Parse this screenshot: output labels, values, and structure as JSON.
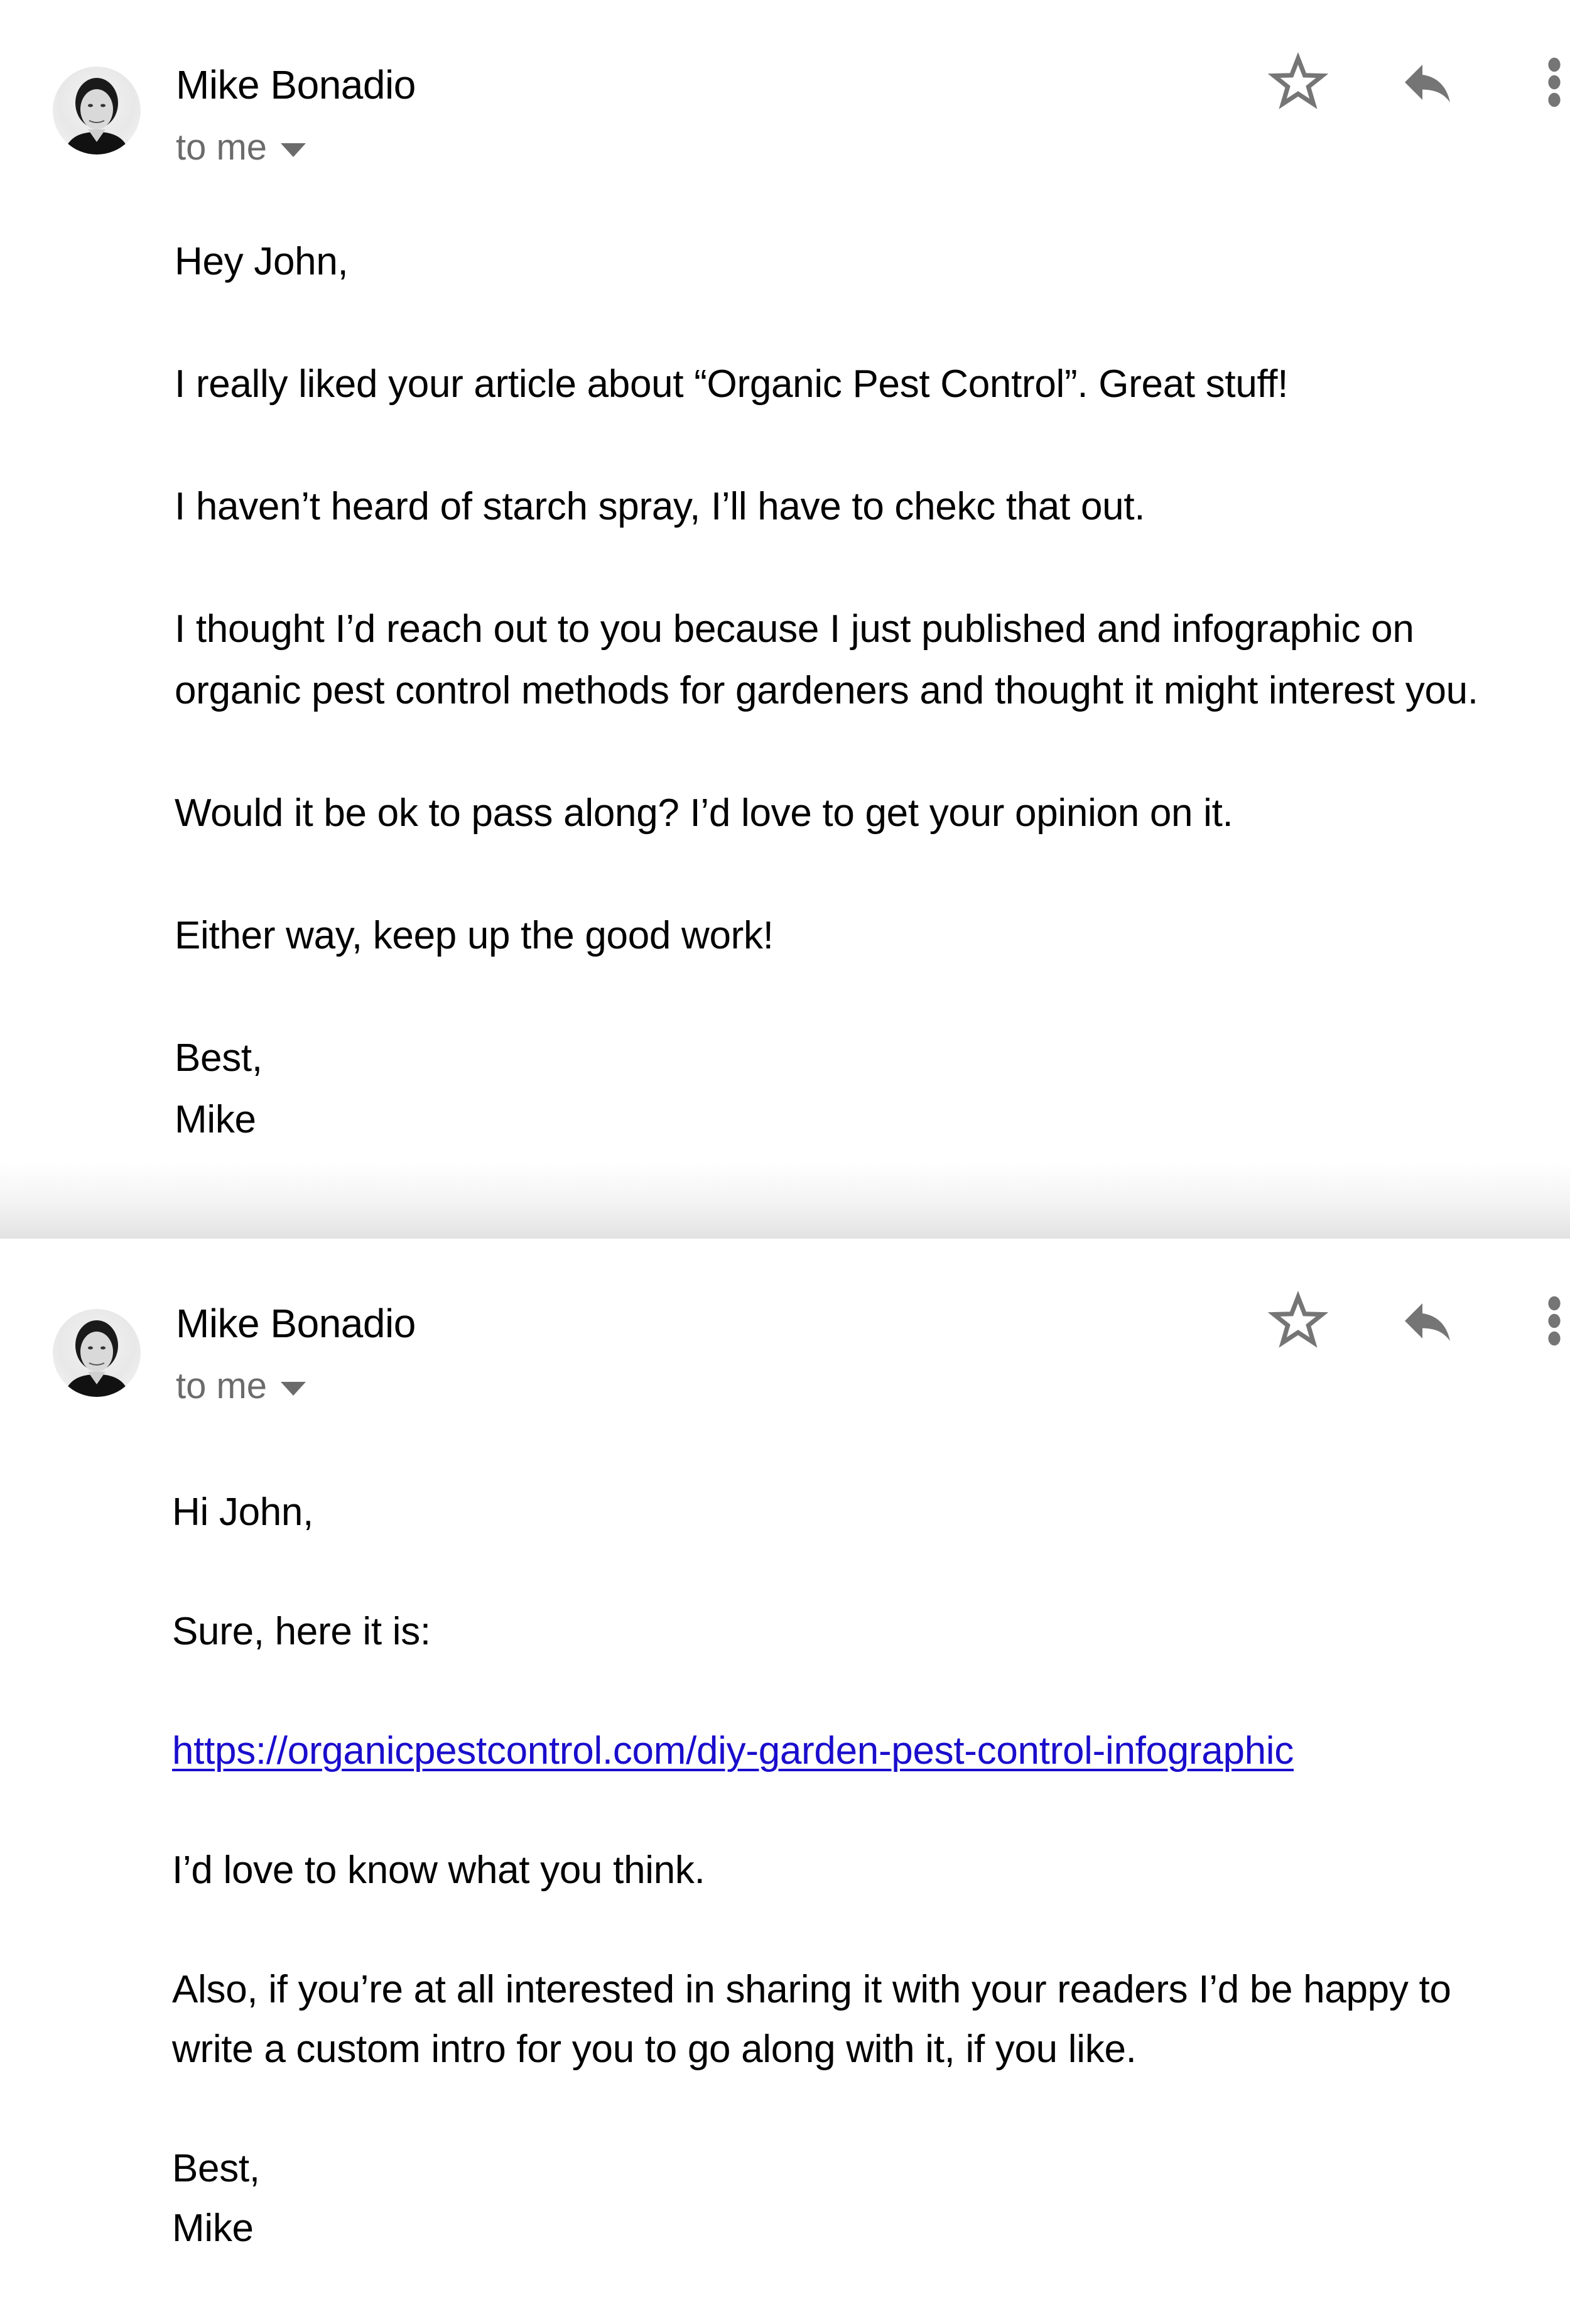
{
  "emails": [
    {
      "sender": "Mike Bonadio",
      "recipient_label": "to me",
      "avatar": "avatar-photo",
      "actions": {
        "star_icon": "star-outline-icon",
        "reply_icon": "reply-icon",
        "more_icon": "more-vertical-icon"
      },
      "greeting": "Hey John,",
      "paragraphs": [
        "I really liked your article about “Organic Pest Control”. Great stuff!",
        "I haven’t heard of starch spray, I’ll have to chekc that out.",
        "I thought I’d reach out to you because I just published and infographic on organic pest control methods for gardeners and thought it might interest you.",
        "Would it be ok to pass along? I’d love to get your opinion on it.",
        "Either way, keep up the good work!"
      ],
      "signoff": "Best,",
      "signature": "Mike"
    },
    {
      "sender": "Mike Bonadio",
      "recipient_label": "to me",
      "avatar": "avatar-photo",
      "actions": {
        "star_icon": "star-outline-icon",
        "reply_icon": "reply-icon",
        "more_icon": "more-vertical-icon"
      },
      "greeting": "Hi John,",
      "paragraphs": [
        "Sure, here it is:"
      ],
      "link": "https://organicpestcontrol.com/diy-garden-pest-control-infographic",
      "paragraphs_after_link": [
        "I’d love to know what you think.",
        "Also, if you’re at all interested in sharing it with your readers I’d be happy to write a custom intro for you to go along with it, if you like."
      ],
      "signoff": "Best,",
      "signature": "Mike"
    }
  ],
  "colors": {
    "link": "#1a0dcc",
    "icon_gray": "#757575",
    "secondary_text": "#6b6b6b"
  }
}
